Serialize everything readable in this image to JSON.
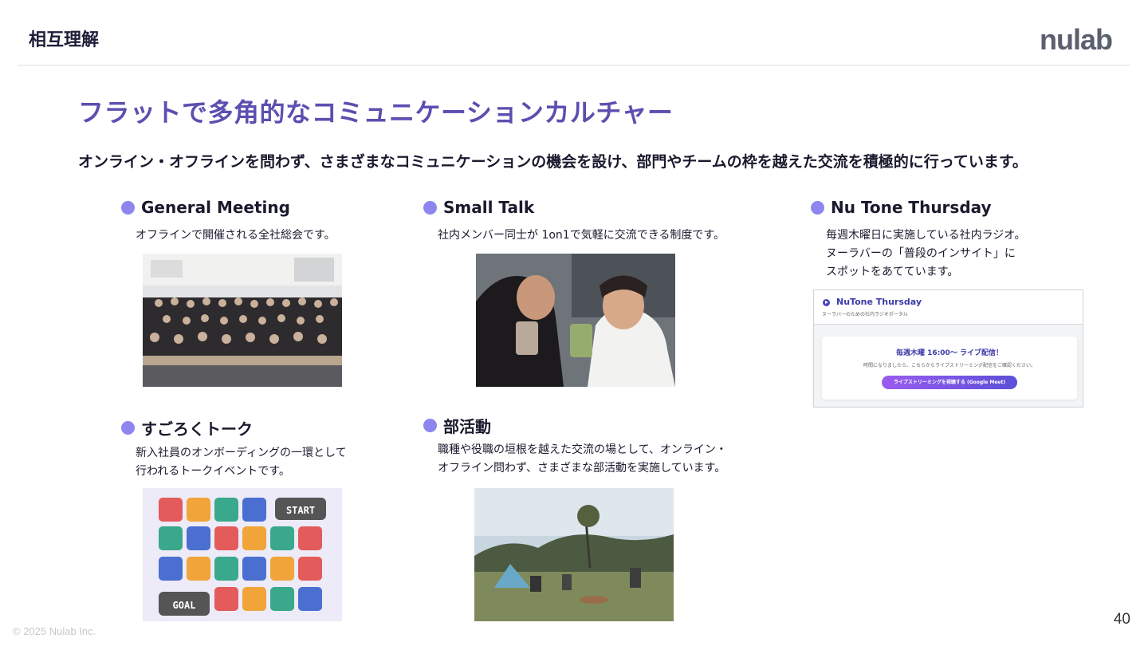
{
  "header": {
    "title": "相互理解",
    "logo_text": "nulab"
  },
  "title": "フラットで多角的なコミュニケーションカルチャー",
  "subtitle": "オンライン・オフラインを問わず、さまざまなコミュニケーションの機会を設け、部門やチームの枠を越えた交流を積極的に行っています。",
  "sections": {
    "general_meeting": {
      "heading": "General Meeting",
      "description": "オフラインで開催される全社総会です。"
    },
    "small_talk": {
      "heading": "Small Talk",
      "description": "社内メンバー同士が 1on1で気軽に交流できる制度です。"
    },
    "nutone": {
      "heading": "Nu Tone Thursday",
      "description_lines": [
        "毎週木曜日に実施している社内ラジオ。",
        "ヌーラバーの「普段のインサイト」に",
        "スポットをあてています。"
      ]
    },
    "sugoroku": {
      "heading": "すごろくトーク",
      "description_lines": [
        "新入社員のオンボーディングの一環として",
        "行われるトークイベントです。"
      ]
    },
    "club": {
      "heading": "部活動",
      "description_lines": [
        "職種や役職の垣根を越えた交流の場として、オンライン・",
        "オフライン問わず、さまざまな部活動を実施しています。"
      ]
    }
  },
  "nutone_card": {
    "title": "NuTone Thursday",
    "subtitle": "ヌーラバーのための社内ラジオポータル",
    "schedule": "毎週木曜 16:00〜 ライブ配信！",
    "note": "時間になりましたら、こちらからライブストリーミング配信をご確認ください。",
    "button": "ライブストリーミングを視聴する (Google Meet)"
  },
  "sugoroku_board": {
    "start": "START",
    "goal": "GOAL"
  },
  "footer": {
    "copyright": "© 2025 Nulab Inc.",
    "page": "40"
  },
  "colors": {
    "accent": "#5b4fb0",
    "bullet": "#8c86ee",
    "logo": "#5a5f6e"
  }
}
